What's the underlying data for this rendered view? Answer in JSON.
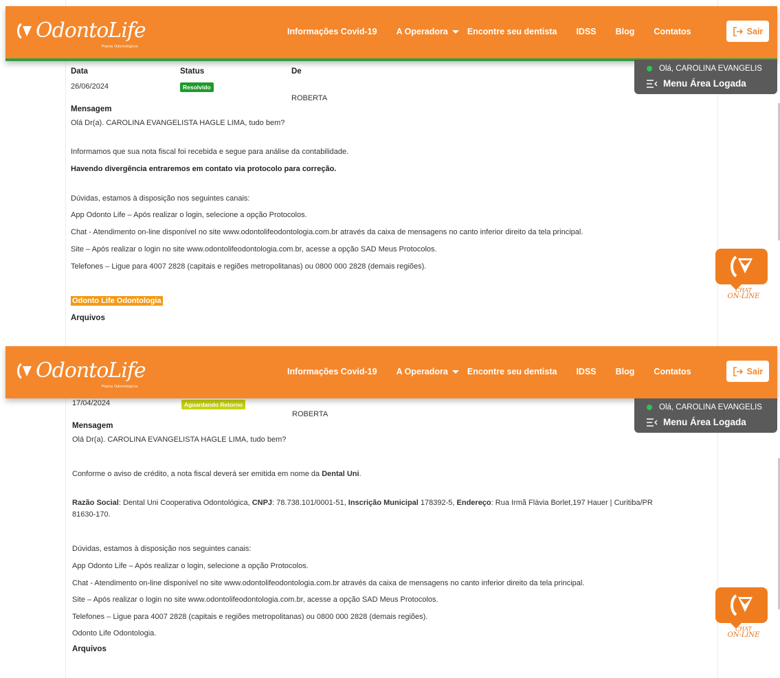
{
  "header": {
    "brand": "OdontoLife",
    "brand_sub": "Planos Odontológicos",
    "nav": [
      {
        "label": "Informações Covid-19"
      },
      {
        "label": "A Operadora"
      },
      {
        "label": "Encontre seu dentista"
      },
      {
        "label": "IDSS"
      },
      {
        "label": "Blog"
      },
      {
        "label": "Contatos"
      }
    ],
    "logout_label": "Sair",
    "user_greeting": "Olá, CAROLINA EVANGELIS",
    "menu_label": "Menu Área Logada"
  },
  "chat": {
    "line1": "CHAT",
    "line2": "ON-LINE"
  },
  "colors": {
    "brand_orange": "#f4872b",
    "online_green": "#2fc450",
    "resolved_green": "#1f9a2c",
    "waiting_yellow": "#c6d40f"
  },
  "message1": {
    "col_data": "Data",
    "col_status": "Status",
    "col_de": "De",
    "date": "26/06/2024",
    "status": "Resolvido",
    "from": "ROBERTA",
    "message_label": "Mensagem",
    "greeting": "Olá Dr(a). CAROLINA EVANGELISTA HAGLE LIMA, tudo bem?",
    "line1": "Informamos que sua nota fiscal foi recebida e segue para análise da contabilidade.",
    "line2_bold": "Havendo divergência entraremos em contato via protocolo para correção.",
    "doubts": "Dúvidas, estamos à disposição nos seguintes canais:",
    "app": "App Odonto Life – Após realizar o login, selecione a opção Protocolos.",
    "chat_line": "Chat - Atendimento on-line disponível no site www.odontolifeodontologia.com.br através da caixa de mensagens no canto inferior direito da tela principal.",
    "site": "Site – Após realizar o login no site www.odontolifeodontologia.com.br, acesse a opção SAD Meus Protocolos.",
    "phones": "Telefones – Ligue para 4007 2828 (capitais e regiões metropolitanas) ou 0800 000 2828 (demais regiões).",
    "signature": "Odonto Life Odontologia",
    "files_label": "Arquivos"
  },
  "message2": {
    "date": "17/04/2024",
    "status": "Aguardando Retorno",
    "from": "ROBERTA",
    "message_label": "Mensagem",
    "greeting": "Olá Dr(a). CAROLINA EVANGELISTA HAGLE LIMA, tudo bem?",
    "line1_pre": "Conforme o aviso de crédito, a nota fiscal deverá ser emitida em nome da ",
    "line1_bold": "Dental Uni",
    "line1_post": ".",
    "razao_label": "Razão Social",
    "razao_value": ": Dental Uni Cooperativa Odontológica, ",
    "cnpj_label": "CNPJ",
    "cnpj_value": ": 78.738.101/0001-51, ",
    "im_label": "Inscrição Municipal",
    "im_value": " 178392-5, ",
    "end_label": "Endereço",
    "end_value": ": Rua Irmã Flávia Borlet,197 Hauer | Curitiba/PR",
    "end_cont": "81630-170.",
    "doubts": "Dúvidas, estamos à disposição nos seguintes canais:",
    "app": "App Odonto Life – Após realizar o login, selecione a opção Protocolos.",
    "chat_line": "Chat - Atendimento on-line disponível no site www.odontolifeodontologia.com.br através da caixa de mensagens no canto inferior direito da tela principal.",
    "site": "Site – Após realizar o login no site www.odontolifeodontologia.com.br, acesse a opção SAD Meus Protocolos.",
    "phones": "Telefones – Ligue para 4007 2828 (capitais e regiões metropolitanas) ou 0800 000 2828 (demais regiões).",
    "signature": "Odonto Life Odontologia.",
    "files_label": "Arquivos"
  }
}
